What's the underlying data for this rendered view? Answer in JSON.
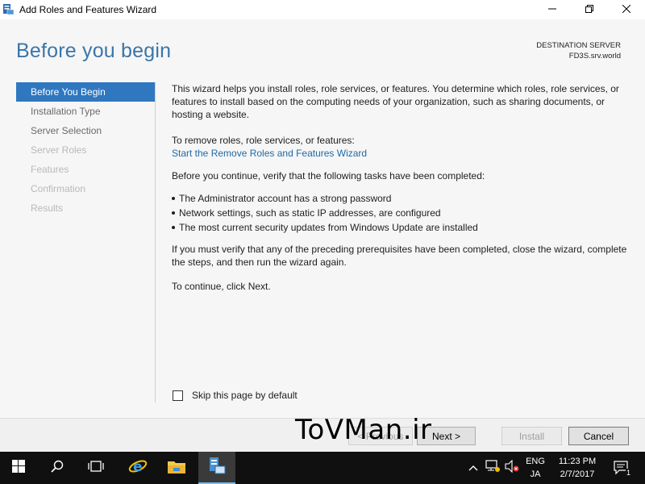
{
  "window": {
    "title": "Add Roles and Features Wizard",
    "minimize_icon": "minimize-icon",
    "maximize_icon": "restore-icon",
    "close_icon": "close-icon"
  },
  "header": {
    "page_title": "Before you begin",
    "destination_label": "DESTINATION SERVER",
    "destination_value": "FD3S.srv.world"
  },
  "nav": {
    "items": [
      {
        "label": "Before You Begin",
        "state": "active"
      },
      {
        "label": "Installation Type",
        "state": "enabled"
      },
      {
        "label": "Server Selection",
        "state": "enabled"
      },
      {
        "label": "Server Roles",
        "state": "disabled"
      },
      {
        "label": "Features",
        "state": "disabled"
      },
      {
        "label": "Confirmation",
        "state": "disabled"
      },
      {
        "label": "Results",
        "state": "disabled"
      }
    ]
  },
  "content": {
    "intro": "This wizard helps you install roles, role services, or features. You determine which roles, role services, or features to install based on the computing needs of your organization, such as sharing documents, or hosting a website.",
    "remove_label": "To remove roles, role services, or features:",
    "remove_link": "Start the Remove Roles and Features Wizard",
    "verify_text": "Before you continue, verify that the following tasks have been completed:",
    "bullets": [
      "The Administrator account has a strong password",
      "Network settings, such as static IP addresses, are configured",
      "The most current security updates from Windows Update are installed"
    ],
    "prereq_text": "If you must verify that any of the preceding prerequisites have been completed, close the wizard, complete the steps, and then run the wizard again.",
    "continue_text": "To continue, click Next.",
    "skip_label": "Skip this page by default",
    "skip_checked": false
  },
  "footer": {
    "previous_label": "< Previous",
    "next_label": "Next >",
    "install_label": "Install",
    "cancel_label": "Cancel"
  },
  "watermark": "ToVMan.ir",
  "taskbar": {
    "language_top": "ENG",
    "language_bottom": "JA",
    "time": "11:23 PM",
    "date": "2/7/2017",
    "apps": [
      "start-icon",
      "search-icon",
      "task-view-icon",
      "internet-explorer-icon",
      "file-explorer-icon",
      "server-manager-icon"
    ],
    "notification_count": "1"
  },
  "colors": {
    "accent": "#2f78c0",
    "title": "#3a76a8",
    "link": "#1f6aa6"
  }
}
